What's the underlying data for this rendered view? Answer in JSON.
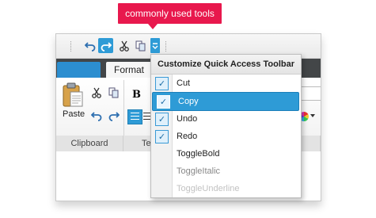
{
  "callout": {
    "text": "commonly used tools",
    "color": "#e8184d"
  },
  "quick_access": {
    "buttons": [
      {
        "name": "undo-icon",
        "active": false
      },
      {
        "name": "redo-icon",
        "active": true
      },
      {
        "name": "cut-icon",
        "active": false
      },
      {
        "name": "copy-icon",
        "active": false
      },
      {
        "name": "dropdown-arrow-icon",
        "active": true
      }
    ]
  },
  "ribbon": {
    "tabs": {
      "format": "Format"
    },
    "groups": {
      "clipboard": "Clipboard",
      "text_partial": "Te"
    },
    "paste_label": "Paste"
  },
  "menu": {
    "title": "Customize Quick Access Toolbar",
    "items": [
      {
        "label": "Cut",
        "checked": true
      },
      {
        "label": "Copy",
        "checked": true,
        "selected": true
      },
      {
        "label": "Undo",
        "checked": true
      },
      {
        "label": "Redo",
        "checked": true
      },
      {
        "label": "ToggleBold",
        "checked": false
      },
      {
        "label": "ToggleItalic",
        "checked": false
      },
      {
        "label": "ToggleUnderline",
        "checked": false
      }
    ]
  },
  "colors": {
    "accent": "#2e9bd6",
    "tab_bar": "#434648",
    "file_tab": "#2c8ed0"
  }
}
